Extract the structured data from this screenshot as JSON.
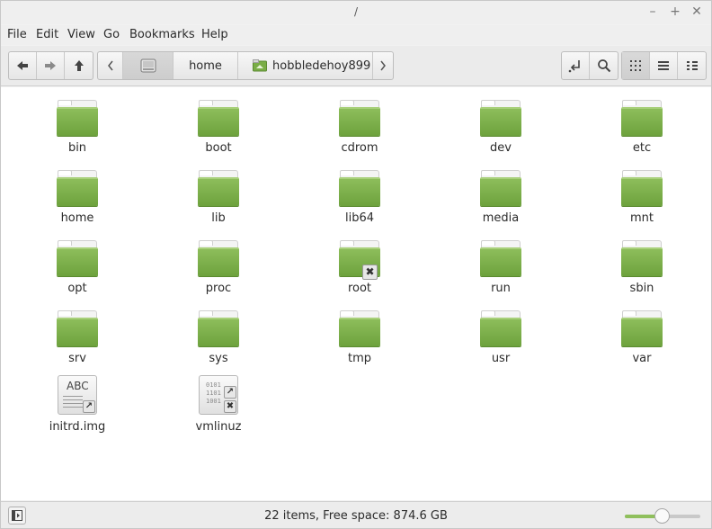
{
  "window": {
    "title": "/"
  },
  "menu": [
    "File",
    "Edit",
    "View",
    "Go",
    "Bookmarks",
    "Help"
  ],
  "path": {
    "segments": [
      "home",
      "hobbledehoy899"
    ]
  },
  "items": [
    {
      "label": "bin",
      "kind": "folder"
    },
    {
      "label": "boot",
      "kind": "folder"
    },
    {
      "label": "cdrom",
      "kind": "folder"
    },
    {
      "label": "dev",
      "kind": "folder"
    },
    {
      "label": "etc",
      "kind": "folder"
    },
    {
      "label": "home",
      "kind": "folder"
    },
    {
      "label": "lib",
      "kind": "folder"
    },
    {
      "label": "lib64",
      "kind": "folder"
    },
    {
      "label": "media",
      "kind": "folder"
    },
    {
      "label": "mnt",
      "kind": "folder"
    },
    {
      "label": "opt",
      "kind": "folder"
    },
    {
      "label": "proc",
      "kind": "folder"
    },
    {
      "label": "root",
      "kind": "folder-locked"
    },
    {
      "label": "run",
      "kind": "folder"
    },
    {
      "label": "sbin",
      "kind": "folder"
    },
    {
      "label": "srv",
      "kind": "folder"
    },
    {
      "label": "sys",
      "kind": "folder"
    },
    {
      "label": "tmp",
      "kind": "folder"
    },
    {
      "label": "usr",
      "kind": "folder"
    },
    {
      "label": "var",
      "kind": "folder"
    },
    {
      "label": "initrd.img",
      "kind": "text-link",
      "icon_text": "ABC"
    },
    {
      "label": "vmlinuz",
      "kind": "binary-link-locked",
      "icon_text": "0101\n1101\n1001"
    }
  ],
  "status": {
    "text": "22 items, Free space: 874.6 GB",
    "zoom_level": 0.5
  },
  "colors": {
    "folder": "#7aad47",
    "accent": "#8fbf5c"
  }
}
